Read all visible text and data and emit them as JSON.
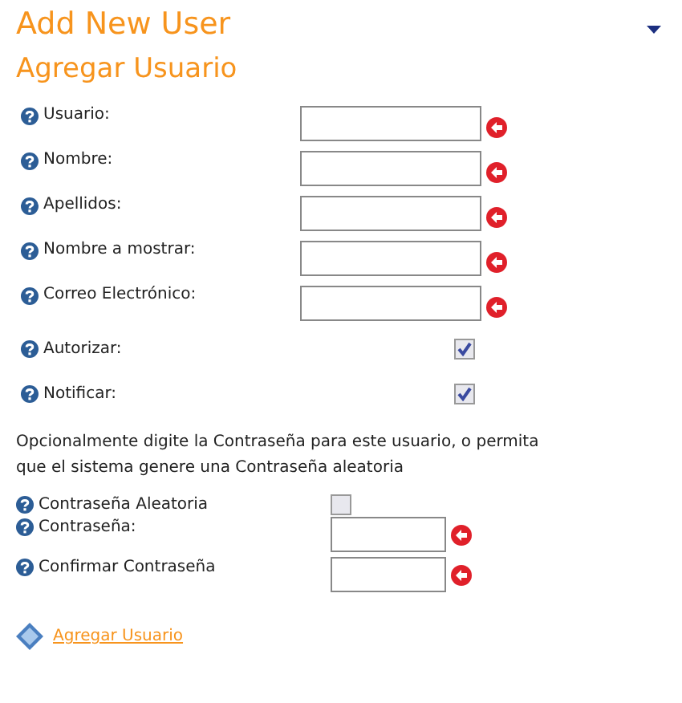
{
  "title": "Add New User",
  "subtitle": "Agregar Usuario",
  "fields": [
    {
      "kind": "text",
      "label": "Usuario:"
    },
    {
      "kind": "text",
      "label": "Nombre:"
    },
    {
      "kind": "text",
      "label": "Apellidos:"
    },
    {
      "kind": "text",
      "label": "Nombre a mostrar:"
    },
    {
      "kind": "text",
      "label": "Correo Electrónico:"
    },
    {
      "kind": "checkbox",
      "label": "Autorizar:",
      "checked": true
    },
    {
      "kind": "checkbox",
      "label": "Notificar:",
      "checked": true
    }
  ],
  "note": "Opcionalmente digite la Contraseña para este usuario, o permita que el sistema genere una Contraseña aleatoria",
  "password_fields": [
    {
      "kind": "checkbox",
      "label": "Contraseña Aleatoria",
      "checked": false
    },
    {
      "kind": "text",
      "label": "Contraseña:"
    },
    {
      "kind": "text",
      "label": "Confirmar Contraseña"
    }
  ],
  "action_link": "Agregar Usuario"
}
